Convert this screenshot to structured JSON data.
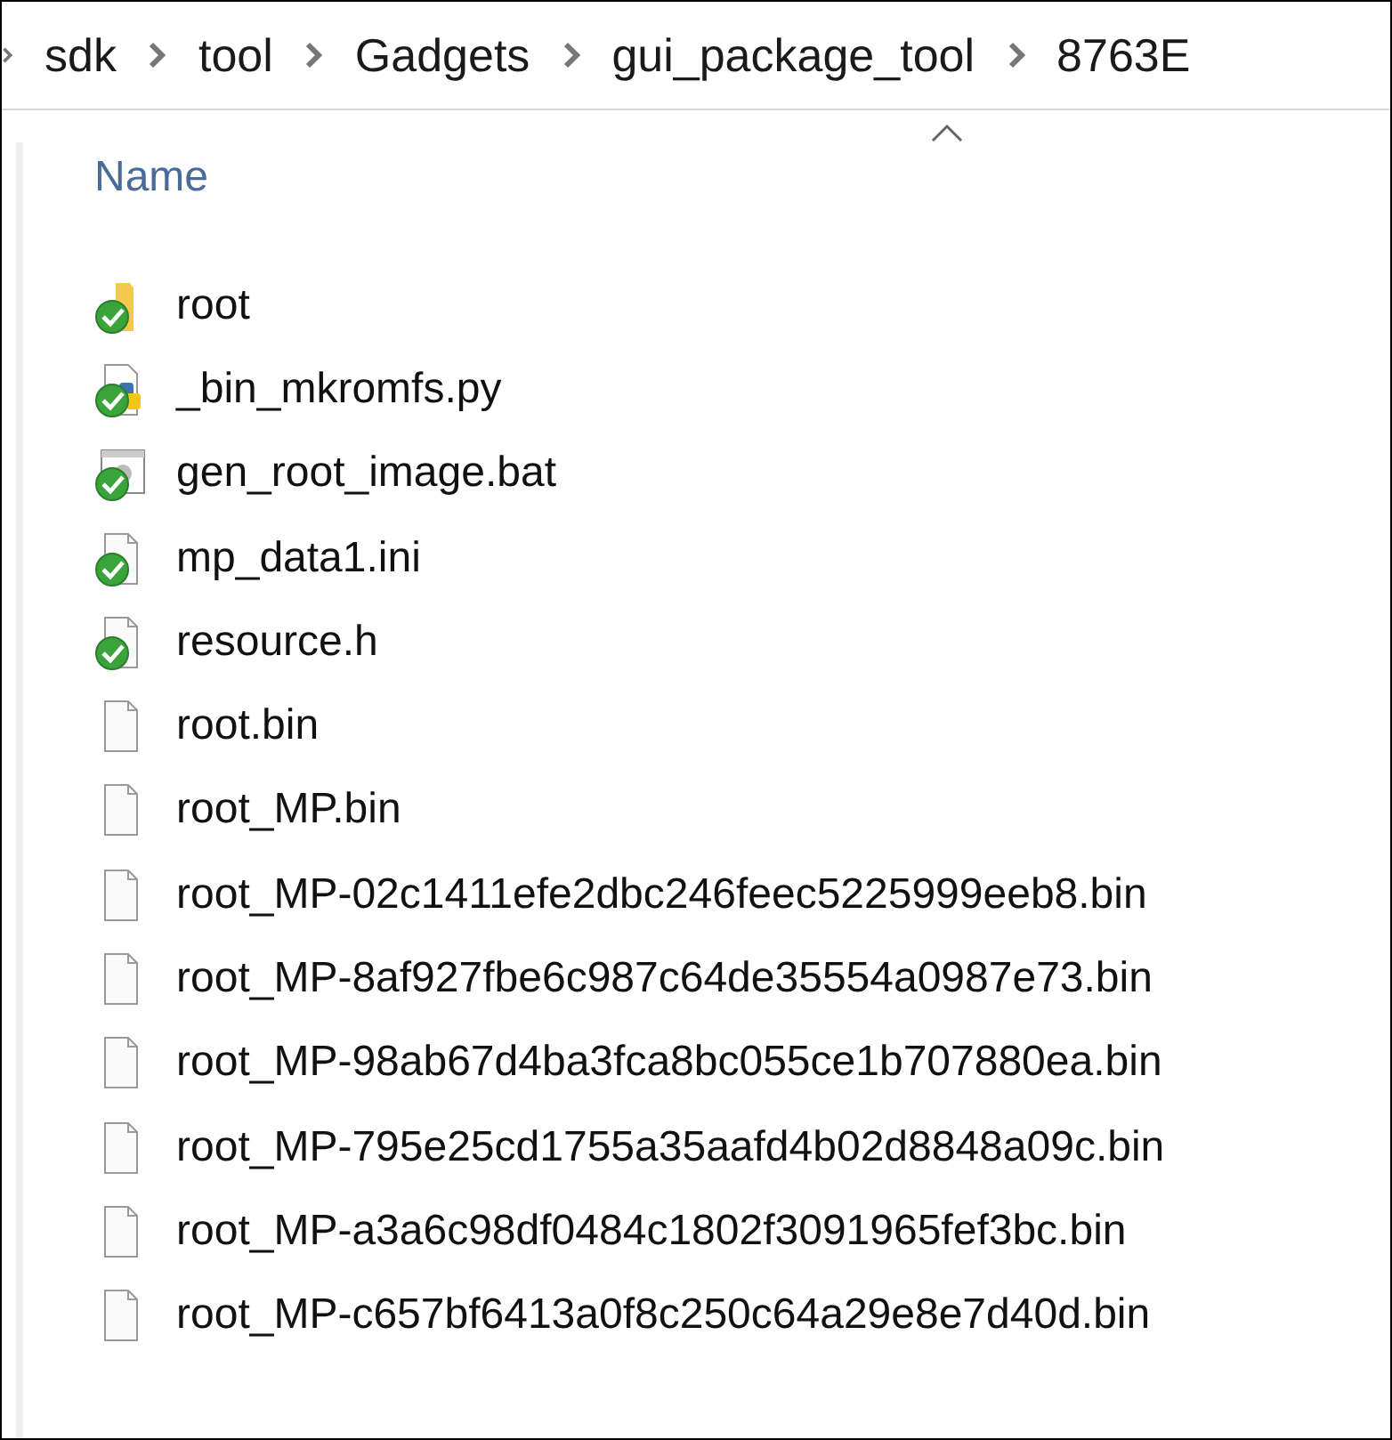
{
  "breadcrumb": [
    "sdk",
    "tool",
    "Gadgets",
    "gui_package_tool",
    "8763E"
  ],
  "header": {
    "label": "Name",
    "sort_ascending": true
  },
  "files": [
    {
      "name": "root",
      "kind": "folder",
      "synced": true
    },
    {
      "name": "_bin_mkromfs.py",
      "kind": "python",
      "synced": true
    },
    {
      "name": "gen_root_image.bat",
      "kind": "batch",
      "synced": true
    },
    {
      "name": "mp_data1.ini",
      "kind": "file",
      "synced": true
    },
    {
      "name": "resource.h",
      "kind": "file",
      "synced": true
    },
    {
      "name": "root.bin",
      "kind": "file",
      "synced": false
    },
    {
      "name": "root_MP.bin",
      "kind": "file",
      "synced": false
    },
    {
      "name": "root_MP-02c1411efe2dbc246feec5225999eeb8.bin",
      "kind": "file",
      "synced": false
    },
    {
      "name": "root_MP-8af927fbe6c987c64de35554a0987e73.bin",
      "kind": "file",
      "synced": false
    },
    {
      "name": "root_MP-98ab67d4ba3fca8bc055ce1b707880ea.bin",
      "kind": "file",
      "synced": false
    },
    {
      "name": "root_MP-795e25cd1755a35aafd4b02d8848a09c.bin",
      "kind": "file",
      "synced": false
    },
    {
      "name": "root_MP-a3a6c98df0484c1802f3091965fef3bc.bin",
      "kind": "file",
      "synced": false
    },
    {
      "name": "root_MP-c657bf6413a0f8c250c64a29e8e7d40d.bin",
      "kind": "file",
      "synced": false
    }
  ]
}
